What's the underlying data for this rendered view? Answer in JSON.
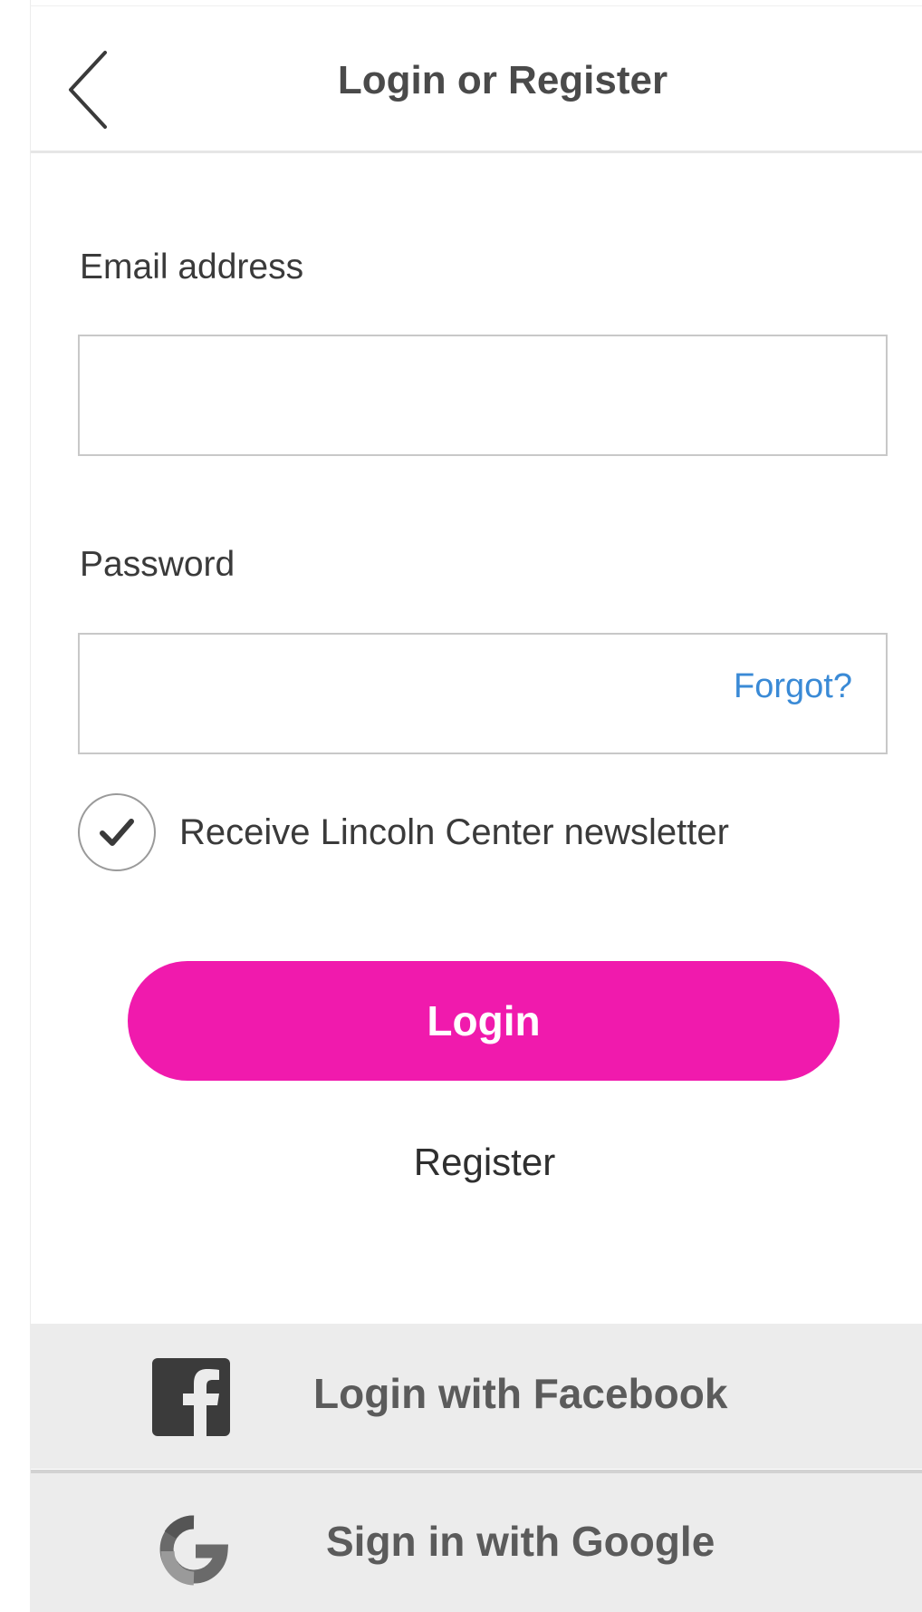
{
  "header": {
    "title": "Login or Register",
    "back_icon": "chevron-left-icon"
  },
  "form": {
    "email": {
      "label": "Email address",
      "value": "",
      "placeholder": ""
    },
    "password": {
      "label": "Password",
      "value": "",
      "placeholder": "",
      "forgot_label": "Forgot?"
    },
    "newsletter": {
      "label": "Receive Lincoln Center newsletter",
      "checked": true
    },
    "login_label": "Login",
    "register_label": "Register"
  },
  "social": {
    "facebook_label": "Login with Facebook",
    "facebook_icon": "facebook-icon",
    "google_label": "Sign in with Google",
    "google_icon": "google-icon"
  },
  "colors": {
    "accent": "#f01aad",
    "link": "#3a8ad6",
    "social_bg": "#ececec",
    "title_text": "#4a4a4a"
  }
}
